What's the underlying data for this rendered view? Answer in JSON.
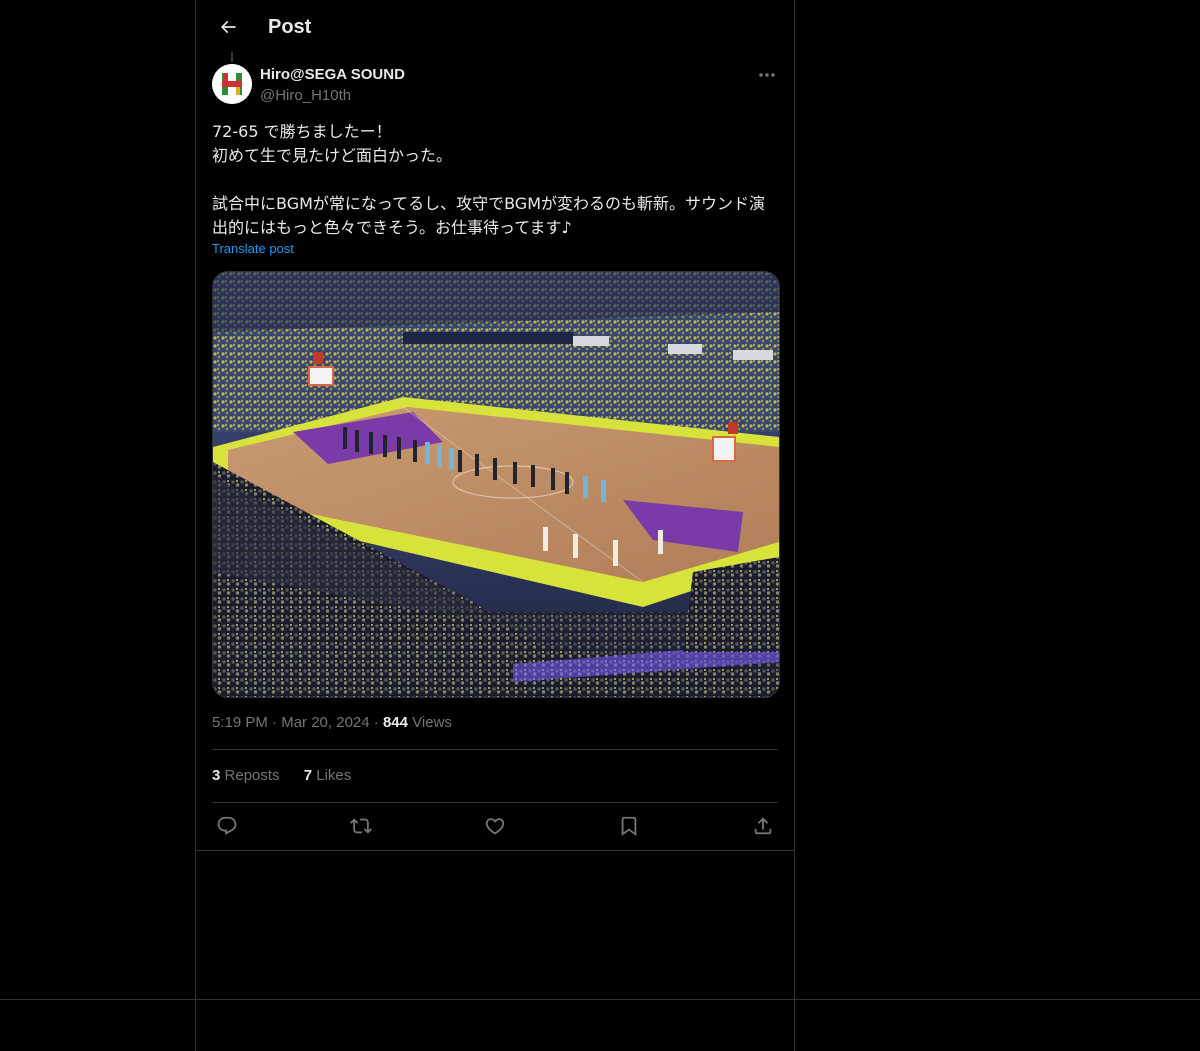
{
  "header": {
    "title": "Post"
  },
  "author": {
    "display_name": "Hiro@SEGA SOUND",
    "handle": "@Hiro_H10th",
    "avatar_letter": "H"
  },
  "post": {
    "text": "72-65 で勝ちましたー！\n初めて生で見たけど面白かった。\n\n試合中にBGMが常になってるし、攻守でBGMが変わるのも斬新。サウンド演出的にはもっと色々できそう。お仕事待ってます♪",
    "translate_label": "Translate post",
    "time": "5:19 PM",
    "date": "Mar 20, 2024",
    "views_count": "844",
    "views_label": "Views"
  },
  "stats": {
    "reposts_count": "3",
    "reposts_label": "Reposts",
    "likes_count": "7",
    "likes_label": "Likes"
  },
  "colors": {
    "background": "#000000",
    "border": "#2f3336",
    "text": "#e7e9ea",
    "muted": "#71767b",
    "link": "#1d9bf0"
  },
  "icons": [
    "back-arrow-icon",
    "more-icon",
    "reply-icon",
    "repost-icon",
    "like-icon",
    "bookmark-icon",
    "share-icon"
  ]
}
